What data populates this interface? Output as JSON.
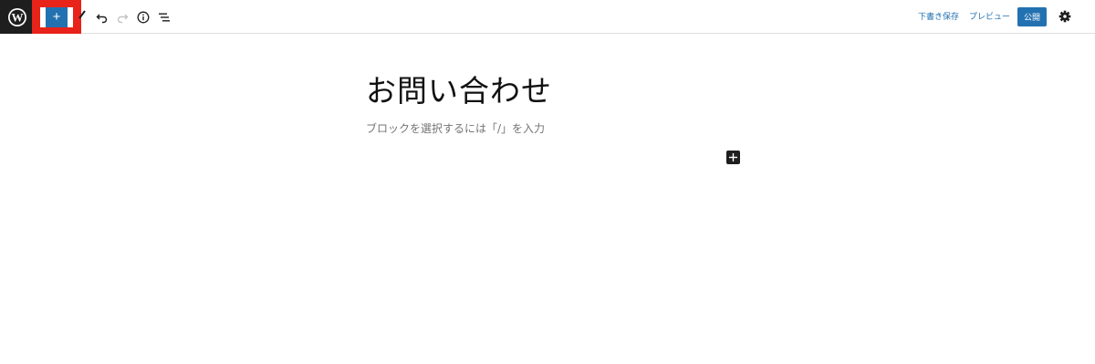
{
  "toolbar": {
    "logo_icon": "wordpress-logo-icon",
    "add_block_icon": "plus-icon",
    "add_block_glyph": "+",
    "tools": [
      "pen-icon",
      "undo-icon",
      "redo-icon",
      "info-icon",
      "list-view-icon"
    ],
    "save_draft_label": "下書き保存",
    "preview_label": "プレビュー",
    "publish_label": "公開",
    "settings_icon": "gear-icon",
    "highlight_color": "#e8231a",
    "accent_color": "#2271b1"
  },
  "editor": {
    "title": "お問い合わせ",
    "block_placeholder": "ブロックを選択するには「/」を入力",
    "inline_add_icon": "plus-icon"
  }
}
